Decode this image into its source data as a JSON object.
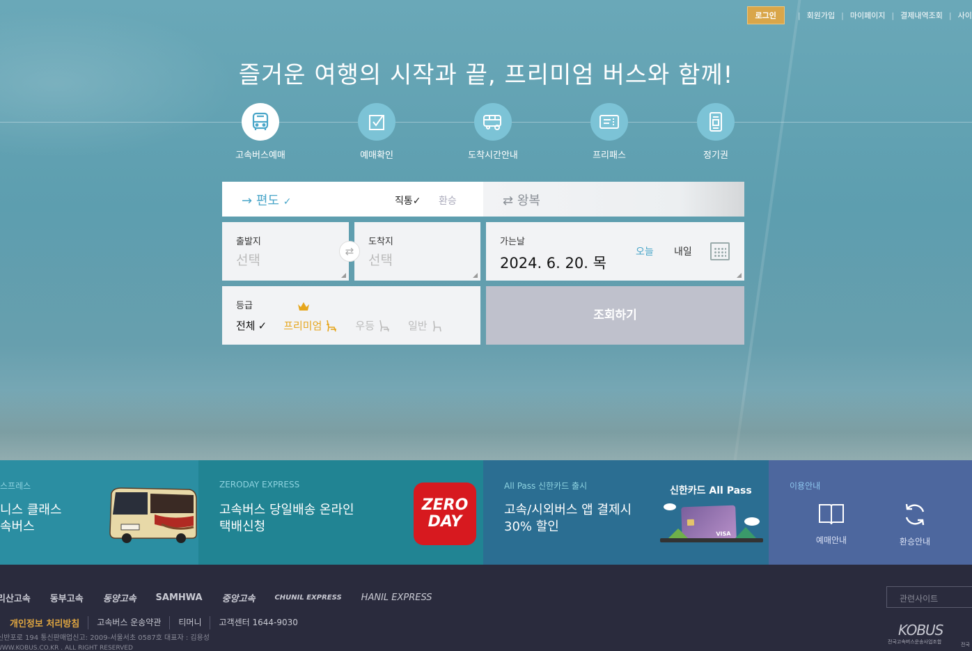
{
  "topnav": {
    "login": "로그인",
    "signup": "회원가입",
    "mypage": "마이페이지",
    "payments": "결제내역조회",
    "sitemap": "사이트"
  },
  "headline": "즐거운 여행의 시작과 끝, 프리미엄 버스와 함께!",
  "menu": [
    {
      "label": "고속버스예매",
      "icon": "bus-icon"
    },
    {
      "label": "예매확인",
      "icon": "checkbox-icon"
    },
    {
      "label": "도착시간안내",
      "icon": "arrival-bus-icon"
    },
    {
      "label": "프리패스",
      "icon": "ticket-icon"
    },
    {
      "label": "정기권",
      "icon": "season-pass-icon"
    }
  ],
  "trip": {
    "oneway": "편도",
    "direct": "직통",
    "transfer": "환승",
    "roundtrip": "왕복"
  },
  "departure": {
    "label": "출발지",
    "value": "선택"
  },
  "arrival": {
    "label": "도착지",
    "value": "선택"
  },
  "date": {
    "label": "가는날",
    "value": "2024. 6. 20. 목",
    "today": "오늘",
    "tomorrow": "내일"
  },
  "grade": {
    "label": "등급",
    "all": "전체",
    "premium": "프리미엄",
    "excellent": "우등",
    "normal": "일반"
  },
  "search_button": "조회하기",
  "tiles": {
    "t1": {
      "kicker": "스프레스",
      "text": "니스 클래스\n속버스"
    },
    "t2": {
      "kicker": "ZERODAY EXPRESS",
      "text": "고속버스 당일배송 온라인\n택배신청",
      "logo_l1": "ZERO",
      "logo_l2": "DAY"
    },
    "t3": {
      "kicker": "All Pass 신한카드 출시",
      "text": "고속/시외버스 앱 결제시\n30% 할인",
      "card_title": "신한카드 All Pass",
      "card_brand": "VISA"
    },
    "t4": {
      "kicker": "이용안내",
      "reserve": "예매안내",
      "refund": "환승안내"
    }
  },
  "footer": {
    "companies": [
      "리산고속",
      "동부고속",
      "동양고속",
      "SAMHWA",
      "중앙고속",
      "CHUNIL EXPRESS",
      "HANIL EXPRESS"
    ],
    "links": {
      "privacy": "개인정보 처리방침",
      "terms": "고속버스 운송약관",
      "tmoney": "티머니",
      "center": "고객센터 1644-9030"
    },
    "address": "신반포로 194 통신판매업신고: 2009-서울서초 0587호 대표자 : 김용성",
    "copyright": "WWW.KOBUS.CO.KR . ALL RIGHT RESERVED",
    "related": "관련사이트",
    "kobus": "KOBUS",
    "kobus_sub": "전국고속버스운송사업조합",
    "kobus_edge": "전국"
  },
  "colors": {
    "accent_blue": "#4aa6c9",
    "premium_gold": "#e6a61c",
    "login_gold": "#d9a64a",
    "footer_bg": "#2a2b3d"
  }
}
